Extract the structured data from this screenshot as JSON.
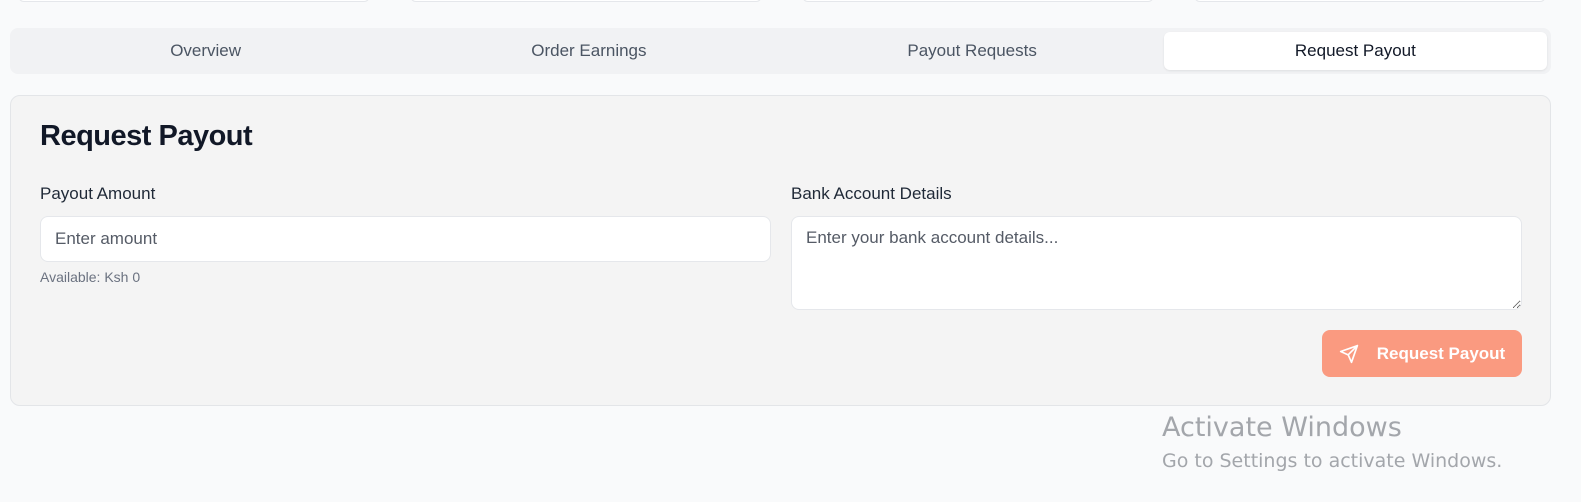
{
  "tabs": [
    {
      "label": "Overview",
      "active": false
    },
    {
      "label": "Order Earnings",
      "active": false
    },
    {
      "label": "Payout Requests",
      "active": false
    },
    {
      "label": "Request Payout",
      "active": true
    }
  ],
  "form": {
    "title": "Request Payout",
    "amount_label": "Payout Amount",
    "amount_placeholder": "Enter amount",
    "amount_value": "",
    "available_text": "Available: Ksh 0",
    "bank_label": "Bank Account Details",
    "bank_placeholder": "Enter your bank account details...",
    "bank_value": "",
    "submit_label": "Request Payout",
    "submit_icon": "send-icon"
  },
  "colors": {
    "accent": "#fa9a80",
    "card_bg": "#f4f4f4",
    "page_bg": "#f9fafb"
  },
  "watermark": {
    "title": "Activate Windows",
    "subtitle": "Go to Settings to activate Windows."
  }
}
